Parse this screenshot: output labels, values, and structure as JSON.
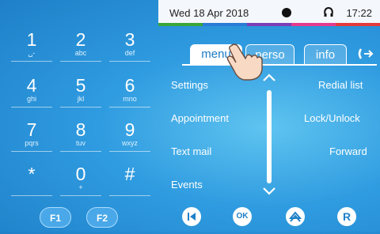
{
  "status": {
    "date": "Wed 18 Apr 2018",
    "time": "17:22",
    "stripes": [
      "#3aa63a",
      "#2a7bd6",
      "#7a3fb7",
      "#e33b8e",
      "#e33b3b"
    ]
  },
  "keypad": [
    {
      "d": "1",
      "l": "␣-"
    },
    {
      "d": "2",
      "l": "abc"
    },
    {
      "d": "3",
      "l": "def"
    },
    {
      "d": "4",
      "l": "ghi"
    },
    {
      "d": "5",
      "l": "jkl"
    },
    {
      "d": "6",
      "l": "mno"
    },
    {
      "d": "7",
      "l": "pqrs"
    },
    {
      "d": "8",
      "l": "tuv"
    },
    {
      "d": "9",
      "l": "wxyz"
    },
    {
      "d": "*",
      "l": ""
    },
    {
      "d": "0",
      "l": "+"
    },
    {
      "d": "#",
      "l": ""
    }
  ],
  "fkeys": [
    "F1",
    "F2"
  ],
  "tabs": {
    "menu": "menu",
    "perso": "perso",
    "info": "info"
  },
  "menu_left": [
    "Settings",
    "Appointment",
    "Text mail",
    "Events"
  ],
  "menu_right": [
    "Redial list",
    "Lock/Unlock",
    "Forward"
  ],
  "nav": {
    "ok": "OK",
    "back_icon": "skip-back-icon",
    "home_icon": "home-icon",
    "redial_icon": "R"
  }
}
